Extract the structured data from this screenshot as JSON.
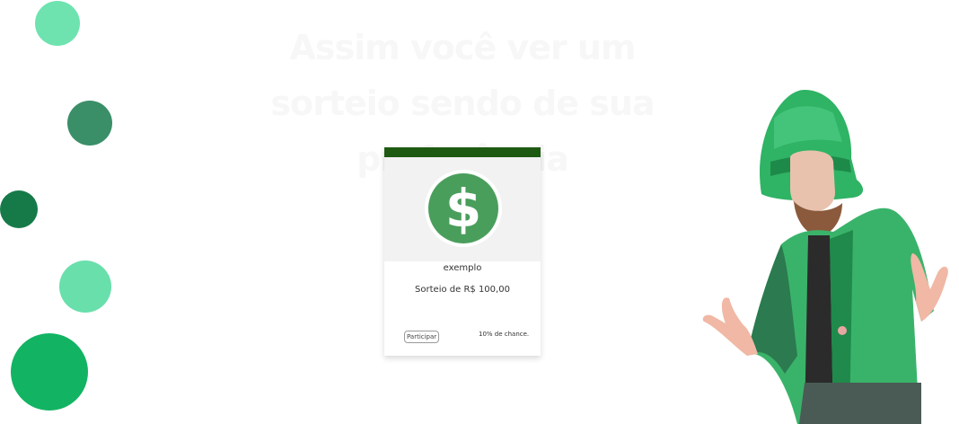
{
  "headline": "Assim você ver um sorteio sendo de sua preferência",
  "card": {
    "name": "exemplo",
    "description": "Sorteio de R$ 100,00",
    "button_label": "Participar",
    "chance": "10% de chance.",
    "icon": "dollar-sign-icon"
  },
  "colors": {
    "card_header": "#1e5a12",
    "coin": "#4a9e5c",
    "accent_green": "#12b463"
  },
  "illustration": "leprechaun-icon"
}
